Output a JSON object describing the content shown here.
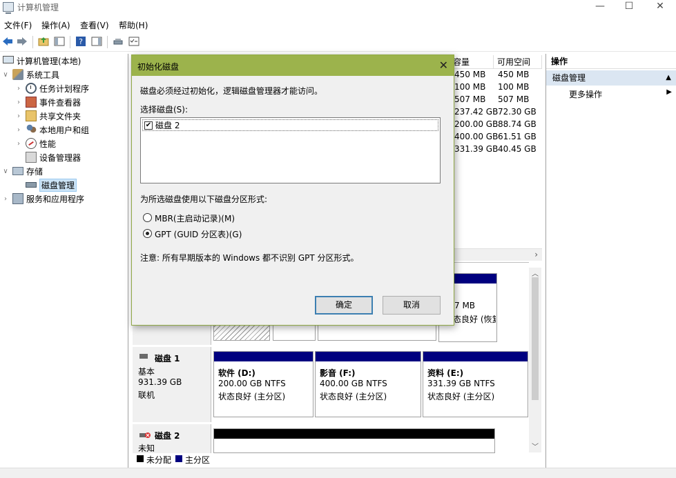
{
  "window": {
    "title": "计算机管理"
  },
  "menu": [
    "文件(F)",
    "操作(A)",
    "查看(V)",
    "帮助(H)"
  ],
  "tree": {
    "root": "计算机管理(本地)",
    "system_tools": "系统工具",
    "task_scheduler": "任务计划程序",
    "event_viewer": "事件查看器",
    "shared_folders": "共享文件夹",
    "local_users": "本地用户和组",
    "performance": "性能",
    "device_manager": "设备管理器",
    "storage": "存储",
    "disk_management": "磁盘管理",
    "services": "服务和应用程序"
  },
  "volume_list": {
    "col_capacity": "容量",
    "col_free": "可用空间",
    "rows": [
      {
        "capacity": "450 MB",
        "free": "450 MB"
      },
      {
        "capacity": "100 MB",
        "free": "100 MB"
      },
      {
        "capacity": "507 MB",
        "free": "507 MB"
      },
      {
        "capacity": "237.42 GB",
        "free": "72.30 GB"
      },
      {
        "capacity": "200.00 GB",
        "free": "88.74 GB"
      },
      {
        "capacity": "400.00 GB",
        "free": "61.51 GB"
      },
      {
        "capacity": "331.39 GB",
        "free": "40.45 GB"
      }
    ]
  },
  "disk0_partial": {
    "size": "7 MB",
    "status": "态良好 (恢复"
  },
  "disk1": {
    "name": "磁盘 1",
    "type": "基本",
    "size": "931.39 GB",
    "state": "联机",
    "partitions": [
      {
        "name": "软件  (D:)",
        "size": "200.00 GB NTFS",
        "status": "状态良好 (主分区)"
      },
      {
        "name": "影音  (F:)",
        "size": "400.00 GB NTFS",
        "status": "状态良好 (主分区)"
      },
      {
        "name": "资料  (E:)",
        "size": "331.39 GB NTFS",
        "status": "状态良好 (主分区)"
      }
    ]
  },
  "disk2": {
    "name": "磁盘 2",
    "state": "未知"
  },
  "legend": {
    "unallocated": "未分配",
    "primary": "主分区"
  },
  "actions": {
    "header": "操作",
    "section": "磁盘管理",
    "more": "更多操作"
  },
  "dialog": {
    "title": "初始化磁盘",
    "intro": "磁盘必须经过初始化，逻辑磁盘管理器才能访问。",
    "select_label": "选择磁盘(S):",
    "disk_item": "磁盘 2",
    "style_label": "为所选磁盘使用以下磁盘分区形式:",
    "mbr_label": "MBR(主启动记录)(M)",
    "gpt_label": "GPT (GUID 分区表)(G)",
    "note": "注意: 所有早期版本的 Windows 都不识别 GPT 分区形式。",
    "ok": "确定",
    "cancel": "取消"
  },
  "colors": {
    "primary_partition": "#00007f",
    "unallocated": "#000000",
    "dialog_title": "#9cb34c",
    "selection": "#cce4f7"
  }
}
